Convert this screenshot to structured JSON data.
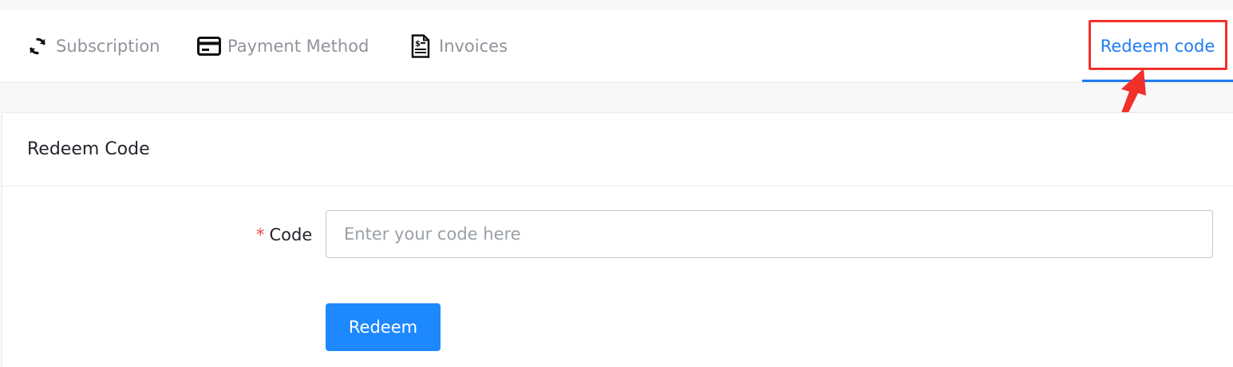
{
  "tabs": [
    {
      "label": "Subscription",
      "icon": "refresh-icon",
      "active": false
    },
    {
      "label": "Payment Method",
      "icon": "credit-card-icon",
      "active": false
    },
    {
      "label": "Invoices",
      "icon": "invoice-icon",
      "active": false
    },
    {
      "label": "Redeem code",
      "icon": null,
      "active": true
    }
  ],
  "card": {
    "title": "Redeem Code"
  },
  "form": {
    "required_mark": "*",
    "code_label": "Code",
    "code_placeholder": "Enter your code here",
    "code_value": "",
    "submit_label": "Redeem"
  },
  "colors": {
    "accent": "#1f7cf2",
    "button": "#1e88ff",
    "annotation": "#f2302a",
    "required": "#f04a4a"
  }
}
